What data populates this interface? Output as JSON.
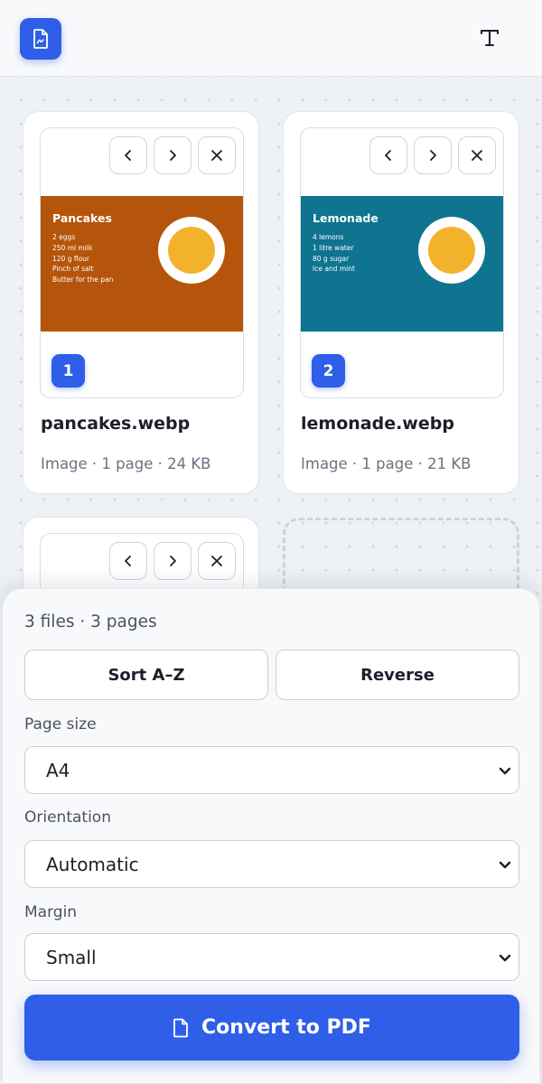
{
  "header": {
    "logo_icon": "pdf-file-icon",
    "text_tool_icon": "text-t-icon",
    "text_tool_glyph": "T"
  },
  "files": [
    {
      "number": "1",
      "name": "pancakes.webp",
      "meta": "Image · 1 page · 24 KB",
      "thumbnail": {
        "title": "Pancakes",
        "lines": [
          "2 eggs",
          "250 ml milk",
          "120 g flour",
          "Pinch of salt",
          "Butter for the pan"
        ],
        "background": "#b5550b"
      }
    },
    {
      "number": "2",
      "name": "lemonade.webp",
      "meta": "Image · 1 page · 21 KB",
      "thumbnail": {
        "title": "Lemonade",
        "lines": [
          "4 lemons",
          "1 litre water",
          "80 g sugar",
          "Ice and mint"
        ],
        "background": "#0e7490"
      }
    }
  ],
  "panel": {
    "summary": "3 files · 3 pages",
    "sort_label": "Sort A–Z",
    "reverse_label": "Reverse",
    "page_size": {
      "label": "Page size",
      "value": "A4"
    },
    "orientation": {
      "label": "Orientation",
      "value": "Automatic"
    },
    "margin": {
      "label": "Margin",
      "value": "Small"
    },
    "convert_label": "Convert to PDF"
  },
  "colors": {
    "accent": "#2f5ee8",
    "plate_yolk": "#f3b22c"
  }
}
